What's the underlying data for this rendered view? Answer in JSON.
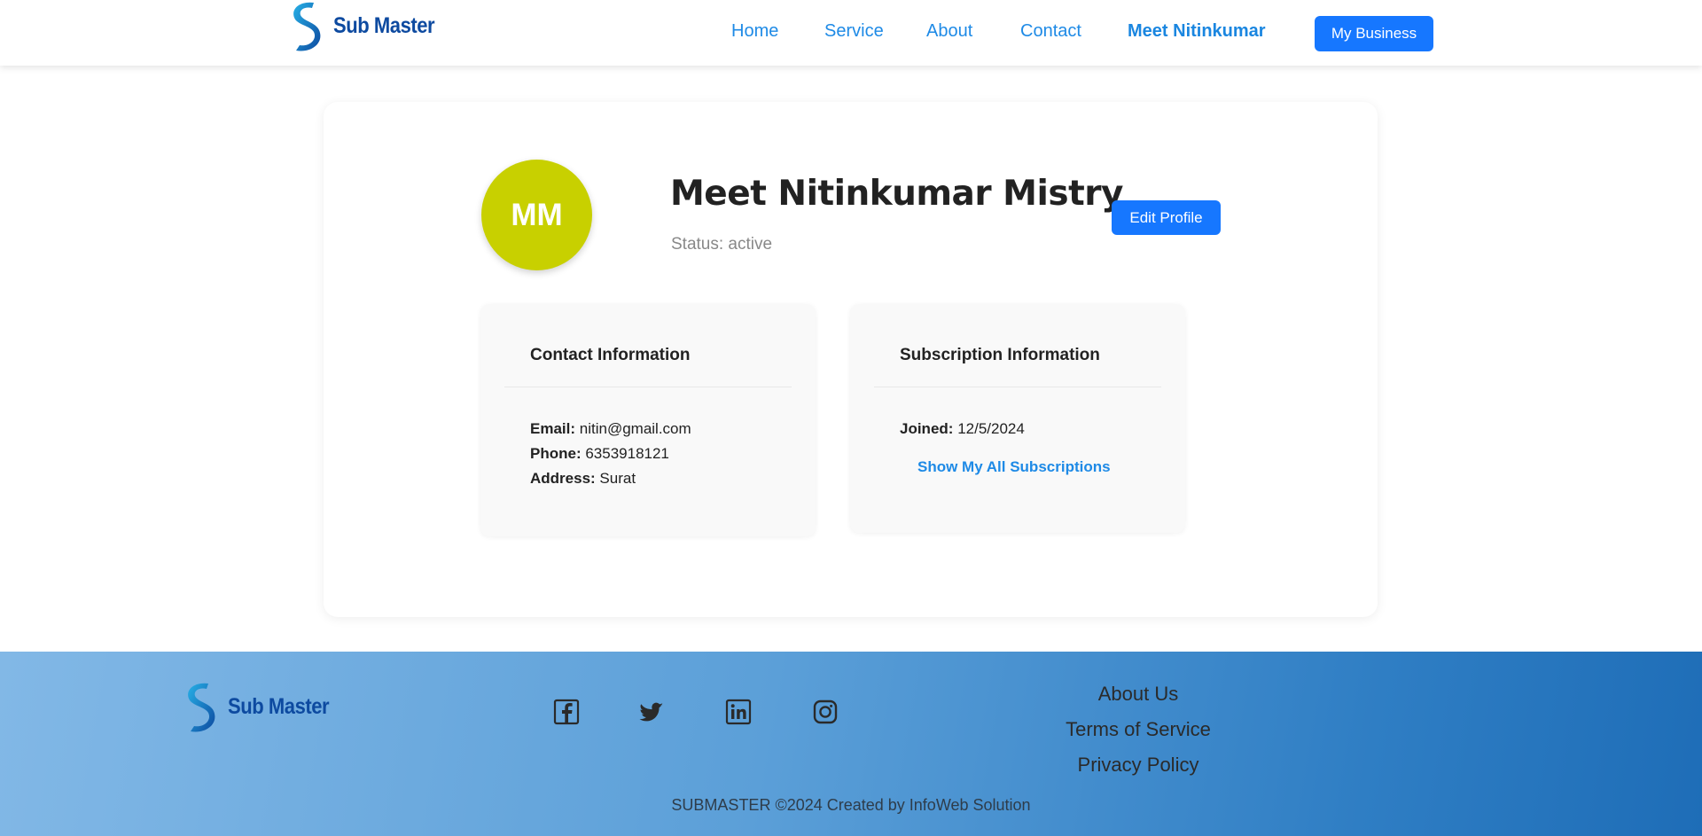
{
  "header": {
    "brand": "Sub Master",
    "nav": [
      {
        "label": "Home"
      },
      {
        "label": "Service"
      },
      {
        "label": "About"
      },
      {
        "label": "Contact"
      },
      {
        "label": "Meet Nitinkumar",
        "active": true
      }
    ],
    "business_button": "My Business"
  },
  "profile": {
    "initials": "MM",
    "avatar_color": "#c8d000",
    "name": "Meet Nitinkumar Mistry",
    "status": "Status: active",
    "edit_button": "Edit Profile"
  },
  "contact": {
    "title": "Contact Information",
    "email_label": "Email:",
    "email": "nitin@gmail.com",
    "phone_label": "Phone:",
    "phone": "6353918121",
    "address_label": "Address:",
    "address": "Surat"
  },
  "subscription": {
    "title": "Subscription Information",
    "joined_label": "Joined:",
    "joined": "12/5/2024",
    "show_link": "Show My All Subscriptions"
  },
  "footer": {
    "brand": "Sub Master",
    "social": [
      {
        "icon": "facebook-icon"
      },
      {
        "icon": "twitter-icon"
      },
      {
        "icon": "linkedin-icon"
      },
      {
        "icon": "instagram-icon"
      }
    ],
    "links": [
      "About Us",
      "Terms of Service",
      "Privacy Policy"
    ],
    "copyright": "SUBMASTER ©2024 Created by InfoWeb Solution"
  },
  "colors": {
    "primary": "#1677ff",
    "link": "#1e8ae6",
    "brand": "#0d4aa0"
  }
}
